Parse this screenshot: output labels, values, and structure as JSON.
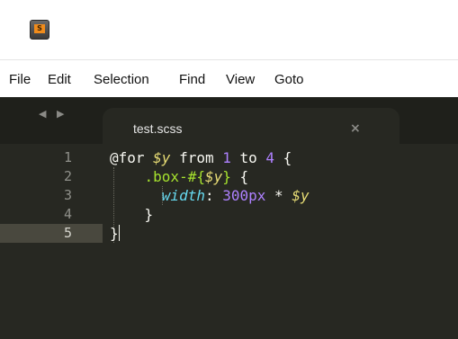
{
  "window": {
    "icon": "sublime-text-app-icon",
    "icon_letter": "S"
  },
  "menu": [
    "File",
    "Edit",
    "Selection",
    "Find",
    "View",
    "Goto"
  ],
  "tabbar": {
    "nav_arrows": "◀ ▶",
    "tab_title": "test.scss",
    "close_glyph": "×"
  },
  "editor": {
    "line_numbers": [
      "1",
      "2",
      "3",
      "4",
      "5"
    ],
    "active_line": 5,
    "lines": [
      [
        {
          "t": "@for ",
          "c": "kw"
        },
        {
          "t": "$y",
          "c": "var"
        },
        {
          "t": " from ",
          "c": "kw"
        },
        {
          "t": "1",
          "c": "num"
        },
        {
          "t": " to ",
          "c": "kw"
        },
        {
          "t": "4",
          "c": "num"
        },
        {
          "t": " {",
          "c": "kw"
        }
      ],
      [
        {
          "t": "    ",
          "c": "kw"
        },
        {
          "t": ".box-#{",
          "c": "sel"
        },
        {
          "t": "$y",
          "c": "var"
        },
        {
          "t": "}",
          "c": "sel"
        },
        {
          "t": " {",
          "c": "kw"
        }
      ],
      [
        {
          "t": "      ",
          "c": "kw"
        },
        {
          "t": "width",
          "c": "prop"
        },
        {
          "t": ": ",
          "c": "kw"
        },
        {
          "t": "300",
          "c": "num"
        },
        {
          "t": "px",
          "c": "num"
        },
        {
          "t": " * ",
          "c": "kw"
        },
        {
          "t": "$y",
          "c": "var"
        }
      ],
      [
        {
          "t": "    }",
          "c": "kw"
        }
      ],
      [
        {
          "t": "}",
          "c": "kw"
        }
      ]
    ]
  },
  "colors": {
    "editor_bg": "#272822",
    "tabbar_bg": "#1f201b",
    "active_line_gutter": "#49483e",
    "variable": "#e6db74",
    "number": "#ae81ff",
    "selector": "#a6e22e",
    "property": "#66d9ef"
  }
}
